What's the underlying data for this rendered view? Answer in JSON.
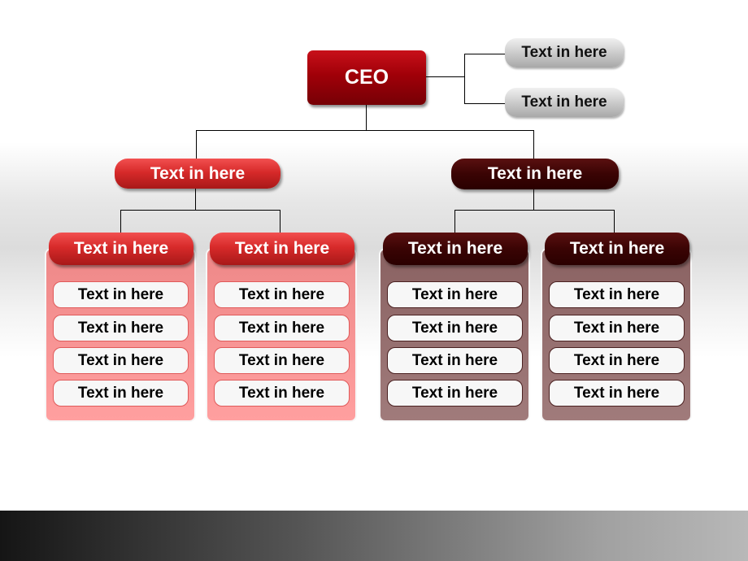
{
  "ceo": {
    "label": "CEO"
  },
  "assistants": [
    {
      "label": "Text in here"
    },
    {
      "label": "Text in here"
    }
  ],
  "divisions": [
    {
      "label": "Text in here",
      "color": "#d72a2a",
      "departments": [
        {
          "label": "Text in here",
          "items": [
            "Text in here",
            "Text in here",
            "Text in here",
            "Text in here"
          ]
        },
        {
          "label": "Text in here",
          "items": [
            "Text in here",
            "Text in here",
            "Text in here",
            "Text in here"
          ]
        }
      ]
    },
    {
      "label": "Text in here",
      "color": "#3a0404",
      "departments": [
        {
          "label": "Text in here",
          "items": [
            "Text in here",
            "Text in here",
            "Text in here",
            "Text in here"
          ]
        },
        {
          "label": "Text in here",
          "items": [
            "Text in here",
            "Text in here",
            "Text in here",
            "Text in here"
          ]
        }
      ]
    }
  ]
}
